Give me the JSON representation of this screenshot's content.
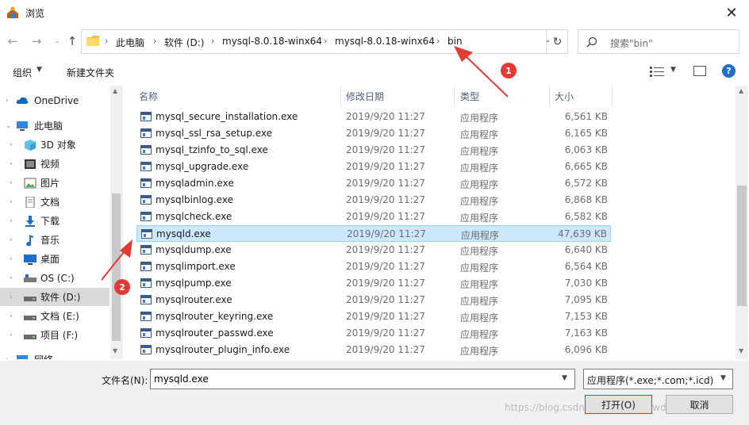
{
  "window": {
    "title": "浏览",
    "close_glyph": "✕"
  },
  "address": {
    "crumbs": [
      "此电脑",
      "软件 (D:)",
      "mysql-8.0.18-winx64",
      "mysql-8.0.18-winx64",
      "bin"
    ],
    "separator": "›"
  },
  "search": {
    "placeholder": "搜索\"bin\""
  },
  "toolbar": {
    "organize": "组织",
    "new_folder": "新建文件夹"
  },
  "nav": {
    "items": [
      {
        "label": "OneDrive",
        "icon": "cloud-icon"
      },
      {
        "label": "此电脑",
        "icon": "computer-icon"
      },
      {
        "label": "3D 对象",
        "icon": "cube-icon"
      },
      {
        "label": "视频",
        "icon": "video-icon"
      },
      {
        "label": "图片",
        "icon": "picture-icon"
      },
      {
        "label": "文档",
        "icon": "document-icon"
      },
      {
        "label": "下载",
        "icon": "download-icon"
      },
      {
        "label": "音乐",
        "icon": "music-icon"
      },
      {
        "label": "桌面",
        "icon": "desktop-icon"
      },
      {
        "label": "OS (C:)",
        "icon": "drive-icon"
      },
      {
        "label": "软件 (D:)",
        "icon": "drive-icon"
      },
      {
        "label": "文档 (E:)",
        "icon": "drive-icon"
      },
      {
        "label": "项目 (F:)",
        "icon": "drive-icon"
      },
      {
        "label": "网络",
        "icon": "network-icon"
      }
    ],
    "selected": "软件 (D:)"
  },
  "columns": {
    "name": "名称",
    "date": "修改日期",
    "type": "类型",
    "size": "大小"
  },
  "files": [
    {
      "name": "mysql_secure_installation.exe",
      "date": "2019/9/20 11:27",
      "type": "应用程序",
      "size": "6,561 KB"
    },
    {
      "name": "mysql_ssl_rsa_setup.exe",
      "date": "2019/9/20 11:27",
      "type": "应用程序",
      "size": "6,165 KB"
    },
    {
      "name": "mysql_tzinfo_to_sql.exe",
      "date": "2019/9/20 11:27",
      "type": "应用程序",
      "size": "6,063 KB"
    },
    {
      "name": "mysql_upgrade.exe",
      "date": "2019/9/20 11:27",
      "type": "应用程序",
      "size": "6,665 KB"
    },
    {
      "name": "mysqladmin.exe",
      "date": "2019/9/20 11:27",
      "type": "应用程序",
      "size": "6,572 KB"
    },
    {
      "name": "mysqlbinlog.exe",
      "date": "2019/9/20 11:27",
      "type": "应用程序",
      "size": "6,868 KB"
    },
    {
      "name": "mysqlcheck.exe",
      "date": "2019/9/20 11:27",
      "type": "应用程序",
      "size": "6,582 KB"
    },
    {
      "name": "mysqld.exe",
      "date": "2019/9/20 11:27",
      "type": "应用程序",
      "size": "47,639 KB"
    },
    {
      "name": "mysqldump.exe",
      "date": "2019/9/20 11:27",
      "type": "应用程序",
      "size": "6,640 KB"
    },
    {
      "name": "mysqlimport.exe",
      "date": "2019/9/20 11:27",
      "type": "应用程序",
      "size": "6,564 KB"
    },
    {
      "name": "mysqlpump.exe",
      "date": "2019/9/20 11:27",
      "type": "应用程序",
      "size": "7,030 KB"
    },
    {
      "name": "mysqlrouter.exe",
      "date": "2019/9/20 11:27",
      "type": "应用程序",
      "size": "7,095 KB"
    },
    {
      "name": "mysqlrouter_keyring.exe",
      "date": "2019/9/20 11:27",
      "type": "应用程序",
      "size": "7,153 KB"
    },
    {
      "name": "mysqlrouter_passwd.exe",
      "date": "2019/9/20 11:27",
      "type": "应用程序",
      "size": "7,163 KB"
    },
    {
      "name": "mysqlrouter_plugin_info.exe",
      "date": "2019/9/20 11:27",
      "type": "应用程序",
      "size": "6,096 KB"
    }
  ],
  "selected_file": "mysqld.exe",
  "footer": {
    "filename_label": "文件名(N):",
    "filename_value": "mysqld.exe",
    "filter": "应用程序(*.exe;*.com;*.icd)",
    "open": "打开(O)",
    "cancel": "取消"
  },
  "annotations": {
    "badge1": "1",
    "badge2": "2",
    "accent": "#e53935"
  },
  "watermark": "https://blog.csdn.net/zhengzhewdewezi"
}
